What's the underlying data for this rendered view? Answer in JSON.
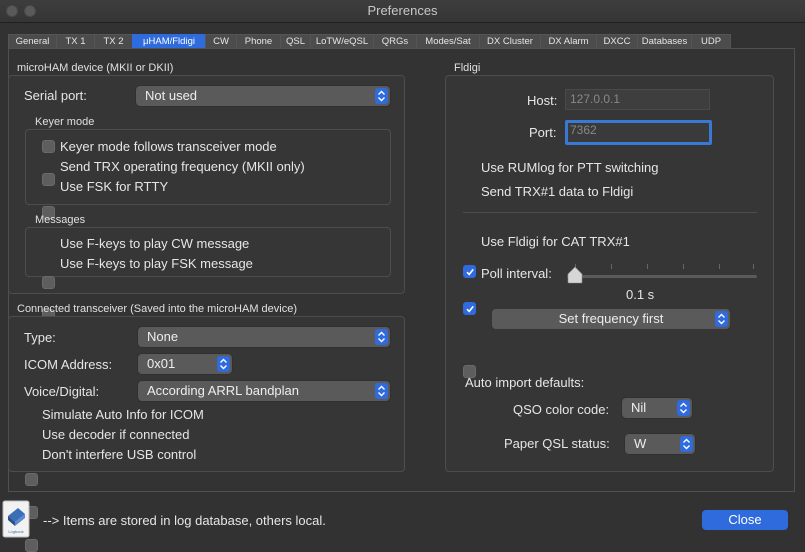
{
  "window": {
    "title": "Preferences"
  },
  "tabs": [
    "General",
    "TX 1",
    "TX 2",
    "μHAM/Fldigi",
    "CW",
    "Phone",
    "QSL",
    "LoTW/eQSL",
    "QRGs",
    "Modes/Sat",
    "DX Cluster",
    "DX Alarm",
    "DXCC",
    "Databases",
    "UDP"
  ],
  "active_tab": "μHAM/Fldigi",
  "microham": {
    "group_label": "microHAM device (MKII or DKII)",
    "serial_port_label": "Serial port:",
    "serial_port_value": "Not used",
    "keyer_mode": {
      "label": "Keyer mode",
      "options": [
        {
          "label": "Keyer mode follows transceiver mode",
          "checked": false
        },
        {
          "label": "Send TRX operating frequency (MKII only)",
          "checked": false
        },
        {
          "label": "Use FSK for RTTY",
          "checked": false
        }
      ]
    },
    "messages": {
      "label": "Messages",
      "options": [
        {
          "label": "Use F-keys to play CW message",
          "checked": false
        },
        {
          "label": "Use F-keys to play FSK message",
          "checked": false
        }
      ]
    }
  },
  "transceiver": {
    "group_label": "Connected transceiver (Saved into the microHAM device)",
    "type_label": "Type:",
    "type_value": "None",
    "icom_label": "ICOM Address:",
    "icom_value": "0x01",
    "voice_label": "Voice/Digital:",
    "voice_value": "According ARRL bandplan",
    "options": [
      {
        "label": "Simulate Auto Info for ICOM",
        "checked": false
      },
      {
        "label": "Use decoder if connected",
        "checked": false
      },
      {
        "label": "Don't interfere USB control",
        "checked": false
      }
    ]
  },
  "fldigi": {
    "group_label": "Fldigi",
    "host_label": "Host:",
    "host_placeholder": "127.0.0.1",
    "port_label": "Port:",
    "port_placeholder": "7362",
    "use_ptt": {
      "label": "Use RUMlog for PTT switching",
      "checked": true
    },
    "send_trx": {
      "label": "Send TRX#1 data to Fldigi",
      "checked": true
    },
    "use_cat": {
      "label": "Use Fldigi for CAT TRX#1",
      "checked": false
    },
    "poll_label": "Poll interval:",
    "poll_value_text": "0.1 s",
    "poll_level": 0,
    "set_freq_value": "Set frequency first",
    "auto_import_label": "Auto import defaults:",
    "qso_color_label": "QSO color code:",
    "qso_color_value": "Nil",
    "paper_qsl_label": "Paper QSL status:",
    "paper_qsl_value": "W"
  },
  "footer": {
    "note": "--> Items are stored in log database, others local.",
    "app_icon": "logbook-icon",
    "icon_caption": "Logbook",
    "close_label": "Close"
  },
  "colors": {
    "accent": "#2f6bdc",
    "background": "#323232"
  }
}
